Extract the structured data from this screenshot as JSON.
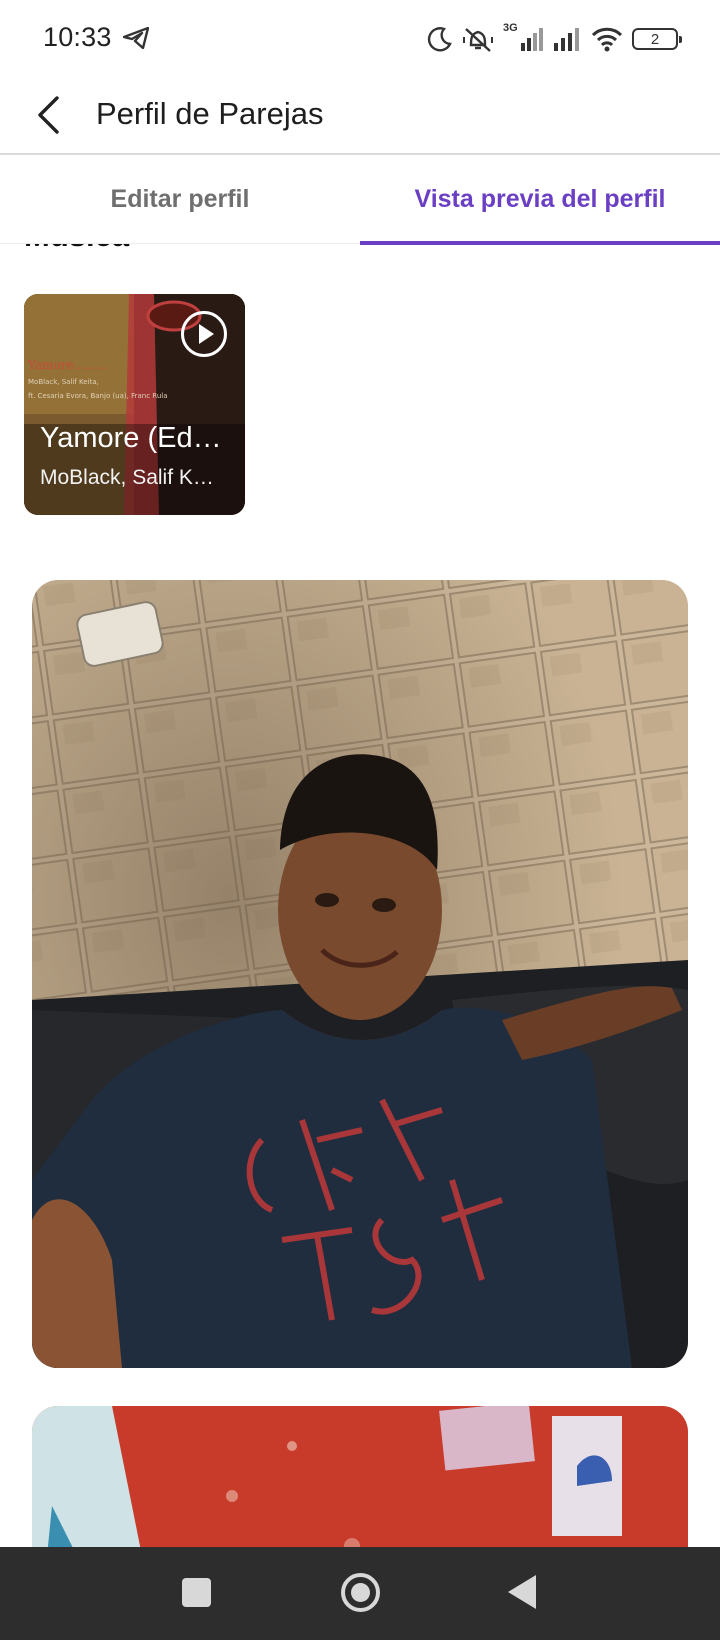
{
  "status_bar": {
    "time": "10:33",
    "network_label": "3G",
    "battery_level": "2",
    "icons": [
      "telegram-icon",
      "moon-icon",
      "vibrate-off-icon",
      "signal-3g-icon",
      "signal-icon",
      "wifi-icon",
      "battery-icon"
    ]
  },
  "app_bar": {
    "title": "Perfil de Parejas",
    "back_icon": "chevron-left-icon"
  },
  "tabs": [
    {
      "label": "Editar perfil",
      "active": false
    },
    {
      "label": "Vista previa del perfil",
      "active": true
    }
  ],
  "accent_color": "#6a3fc4",
  "music_section": {
    "title": "Música",
    "track": {
      "title": "Yamore (Ed…",
      "artist": "MoBlack, Salif K…",
      "play_icon": "play-circle-icon"
    }
  },
  "photos": [
    {
      "alt": "profile-photo-1"
    },
    {
      "alt": "profile-photo-2"
    }
  ],
  "nav_bar": {
    "icons": [
      "recents-square-icon",
      "home-circle-icon",
      "back-triangle-icon"
    ]
  }
}
